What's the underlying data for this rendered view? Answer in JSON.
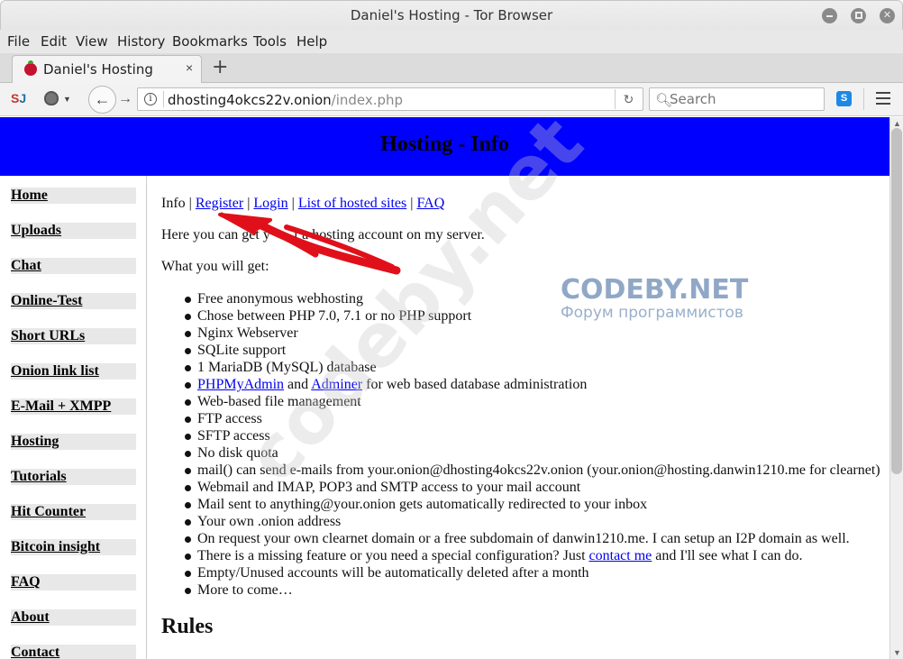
{
  "window": {
    "title": "Daniel's Hosting - Tor Browser"
  },
  "menu": [
    "File",
    "Edit",
    "View",
    "History",
    "Bookmarks",
    "Tools",
    "Help"
  ],
  "tab": {
    "title": "Daniel's Hosting",
    "close": "×",
    "new_tab": "+"
  },
  "navbar": {
    "url_host": "dhosting4okcs22v.onion",
    "url_path": "/index.php",
    "search_placeholder": "Search",
    "ext_label": "S"
  },
  "page": {
    "header_title": "Hosting - Info",
    "sidebar": [
      "Home",
      "Uploads",
      "Chat",
      "Online-Test",
      "Short URLs",
      "Onion link list",
      "E-Mail + XMPP",
      "Hosting",
      "Tutorials",
      "Hit Counter",
      "Bitcoin insight",
      "FAQ",
      "About",
      "Contact"
    ],
    "crumbs": {
      "current": "Info",
      "sep": "|",
      "links": [
        "Register",
        "Login",
        "List of hosted sites",
        "FAQ"
      ]
    },
    "intro_before": "Here you can get y",
    "intro_after": "f a hosting account on my server.",
    "you_get": "What you will get:",
    "features": [
      "Free anonymous webhosting",
      "Chose between PHP 7.0, 7.1 or no PHP support",
      "Nginx Webserver",
      "SQLite support",
      "1 MariaDB (MySQL) database",
      {
        "link1": "PHPMyAdmin",
        "mid": " and ",
        "link2": "Adminer",
        "after": " for web based database administration"
      },
      "Web-based file management",
      "FTP access",
      "SFTP access",
      "No disk quota",
      "mail() can send e-mails from your.onion@dhosting4okcs22v.onion (your.onion@hosting.danwin1210.me for clearnet)",
      "Webmail and IMAP, POP3 and SMTP access to your mail account",
      "Mail sent to anything@your.onion gets automatically redirected to your inbox",
      "Your own .onion address",
      "On request your own clearnet domain or a free subdomain of danwin1210.me. I can setup an I2P domain as well.",
      {
        "before": "There is a missing feature or you need a special configuration? Just ",
        "link": "contact me",
        "after": " and I'll see what I can do."
      },
      "Empty/Unused accounts will be automatically deleted after a month",
      "More to come…"
    ],
    "rules_heading": "Rules"
  },
  "watermark": {
    "diagonal": "codeby.net",
    "brand": "CODEBY.NET",
    "tagline": "Форум программистов"
  },
  "colors": {
    "header_bg": "#0000ff",
    "link": "#0000ee",
    "annotation_red": "#e0101a"
  }
}
